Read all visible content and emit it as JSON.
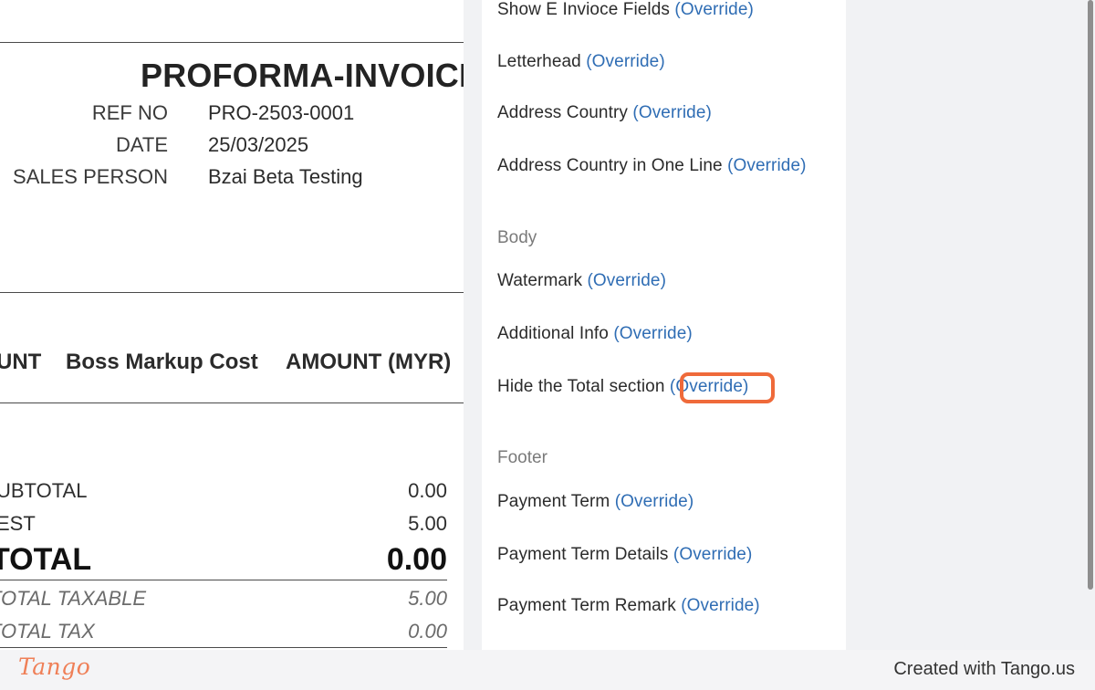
{
  "invoice": {
    "title": "PROFORMA-INVOICE",
    "meta": [
      {
        "label": "REF NO",
        "value": "PRO-2503-0001"
      },
      {
        "label": "DATE",
        "value": "25/03/2025"
      },
      {
        "label": "SALES PERSON",
        "value": "Bzai Beta Testing"
      }
    ],
    "columns": [
      "UNT",
      "Boss Markup Cost",
      "AMOUNT (MYR)"
    ],
    "totals": [
      {
        "label": "UBTOTAL",
        "value": "0.00"
      },
      {
        "label": "EST",
        "value": "5.00"
      },
      {
        "label": "TOTAL",
        "value": "0.00"
      },
      {
        "label": "TOTAL TAXABLE",
        "value": "5.00"
      },
      {
        "label": "TOTAL TAX",
        "value": "0.00"
      }
    ]
  },
  "panel": {
    "items_top": [
      {
        "label": "Show E Invioce Fields",
        "link": "(Override)"
      },
      {
        "label": "Letterhead",
        "link": "(Override)"
      },
      {
        "label": "Address Country",
        "link": "(Override)"
      },
      {
        "label": "Address Country in One Line",
        "link": "(Override)"
      }
    ],
    "body_section": "Body",
    "items_body": [
      {
        "label": "Watermark",
        "link": "(Override)"
      },
      {
        "label": "Additional Info",
        "link": "(Override)"
      },
      {
        "label": "Hide the Total section",
        "link": "(Override)"
      }
    ],
    "footer_section": "Footer",
    "items_footer": [
      {
        "label": "Payment Term",
        "link": "(Override)"
      },
      {
        "label": "Payment Term Details",
        "link": "(Override)"
      },
      {
        "label": "Payment Term Remark",
        "link": "(Override)"
      }
    ]
  },
  "footer": {
    "logo": "Tango",
    "credit": "Created with Tango.us"
  },
  "colors": {
    "link": "#2f6db4",
    "highlight": "#ef6a3a",
    "logo": "#ef7f57"
  }
}
